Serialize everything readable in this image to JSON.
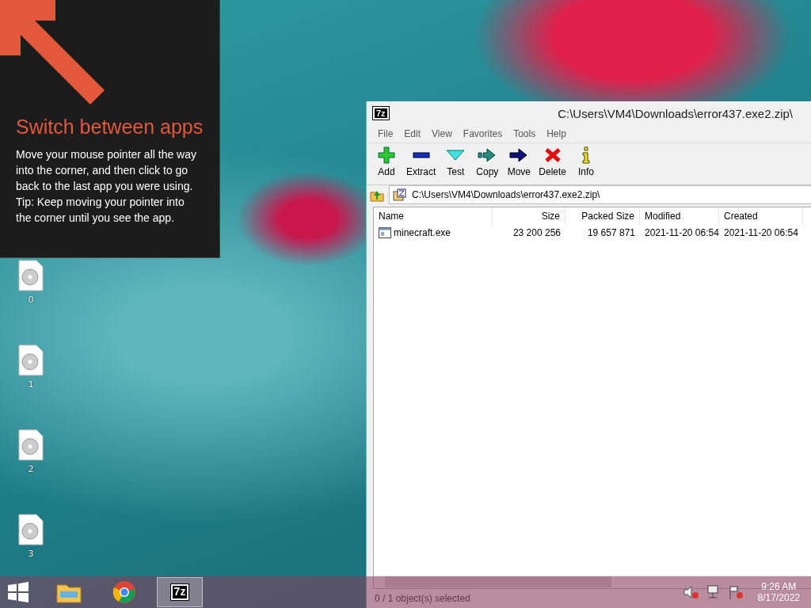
{
  "tip": {
    "title": "Switch between apps",
    "paragraphs": [
      "Move your mouse pointer all the way into the corner, and then click to go back to the last app you were using.",
      "Tip: Keep moving your pointer into the corner until you see the app."
    ]
  },
  "desktop_icons": [
    {
      "label": "0"
    },
    {
      "label": "1"
    },
    {
      "label": "2"
    },
    {
      "label": "3"
    }
  ],
  "window": {
    "logo": "7z",
    "title": "C:\\Users\\VM4\\Downloads\\error437.exe2.zip\\",
    "menu": [
      "File",
      "Edit",
      "View",
      "Favorites",
      "Tools",
      "Help"
    ],
    "toolbar": [
      {
        "kind": "add",
        "label": "Add"
      },
      {
        "kind": "extract",
        "label": "Extract"
      },
      {
        "kind": "test",
        "label": "Test"
      },
      {
        "kind": "copy",
        "label": "Copy"
      },
      {
        "kind": "move",
        "label": "Move"
      },
      {
        "kind": "delete",
        "label": "Delete"
      },
      {
        "kind": "info",
        "label": "Info"
      }
    ],
    "address": "C:\\Users\\VM4\\Downloads\\error437.exe2.zip\\",
    "columns": [
      "Name",
      "Size",
      "Packed Size",
      "Modified",
      "Created"
    ],
    "rows": [
      {
        "selected": false,
        "cells": [
          "minecraft.exe",
          "23 200 256",
          "19 657 871",
          "2021-11-20 06:54",
          "2021-11-20 06:54"
        ]
      }
    ],
    "status": "0 / 1 object(s) selected"
  },
  "taskbar": {
    "apps": [
      {
        "kind": "folder",
        "active": false
      },
      {
        "kind": "browser",
        "active": false
      },
      {
        "kind": "archiver",
        "label": "7z",
        "active": true
      }
    ],
    "time": "9:26 AM",
    "date": "8/17/2022"
  }
}
